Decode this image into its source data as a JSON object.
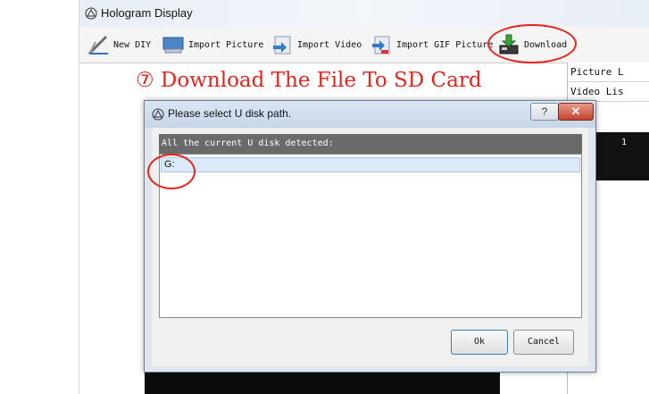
{
  "app": {
    "title": "Hologram Display",
    "title_icon": "app-logo-icon"
  },
  "toolbar": {
    "items": [
      {
        "label": "New DIY",
        "icon": "pencil-ruler-icon"
      },
      {
        "label": "Import Picture",
        "icon": "monitor-icon"
      },
      {
        "label": "Import Video",
        "icon": "video-import-icon"
      },
      {
        "label": "Import GIF Picture",
        "icon": "gif-import-icon"
      },
      {
        "label": "Download",
        "icon": "download-icon"
      }
    ]
  },
  "side_panel": {
    "items": [
      "Picture L",
      "Video Lis"
    ],
    "row_text": "1"
  },
  "annotation": {
    "text": "⑦ Download The File To SD Card",
    "color": "#e8231c"
  },
  "dialog": {
    "title": "Please select U disk path.",
    "help_label": "?",
    "close_label": "✕",
    "header": "All the current U disk detected:",
    "drives": [
      "G:"
    ],
    "ok_label": "Ok",
    "cancel_label": "Cancel"
  }
}
